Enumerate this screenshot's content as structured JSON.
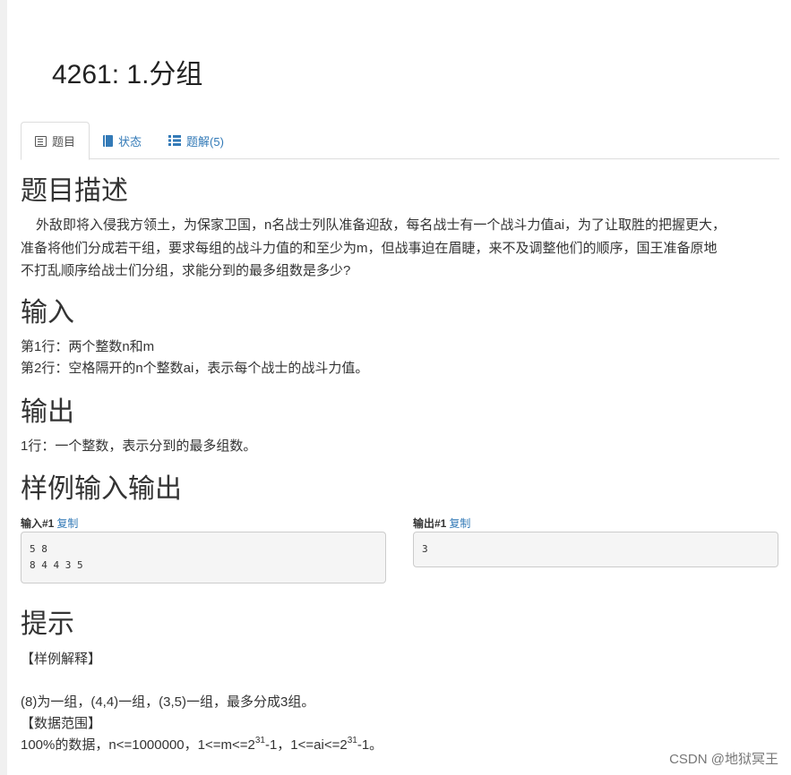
{
  "problem": {
    "title": "4261: 1.分组"
  },
  "tabs": [
    {
      "label": "题目",
      "icon": "list-alt-icon"
    },
    {
      "label": "状态",
      "icon": "book-icon"
    },
    {
      "label": "题解(5)",
      "icon": "th-list-icon"
    }
  ],
  "description": {
    "heading": "题目描述",
    "lines": [
      "外敌即将入侵我方领土，为保家卫国，n名战士列队准备迎敌，每名战士有一个战斗力值ai，为了让取胜的把握更大，",
      "准备将他们分成若干组，要求每组的战斗力值的和至少为m，但战事迫在眉睫，来不及调整他们的顺序，国王准备原地",
      "不打乱顺序给战士们分组，求能分到的最多组数是多少?"
    ]
  },
  "input": {
    "heading": "输入",
    "lines": [
      "第1行：两个整数n和m",
      "第2行：空格隔开的n个整数ai，表示每个战士的战斗力值。"
    ]
  },
  "output": {
    "heading": "输出",
    "lines": [
      "1行：一个整数，表示分到的最多组数。"
    ]
  },
  "samples": {
    "heading": "样例输入输出",
    "copy_label": "复制",
    "input_label": "输入#1",
    "input_value": "5 8\n8 4 4 3 5",
    "output_label": "输出#1",
    "output_value": "3"
  },
  "hint": {
    "heading": "提示",
    "line1": "【样例解释】",
    "line2": "(8)为一组，(4,4)一组，(3,5)一组，最多分成3组。",
    "line3": "【数据范围】",
    "range_a": "100%的数据，n<=1000000，1<=m<=2",
    "exp1": "31",
    "range_b": "-1，1<=ai<=2",
    "exp2": "31",
    "range_c": "-1。"
  },
  "watermark": "CSDN @地狱冥王"
}
